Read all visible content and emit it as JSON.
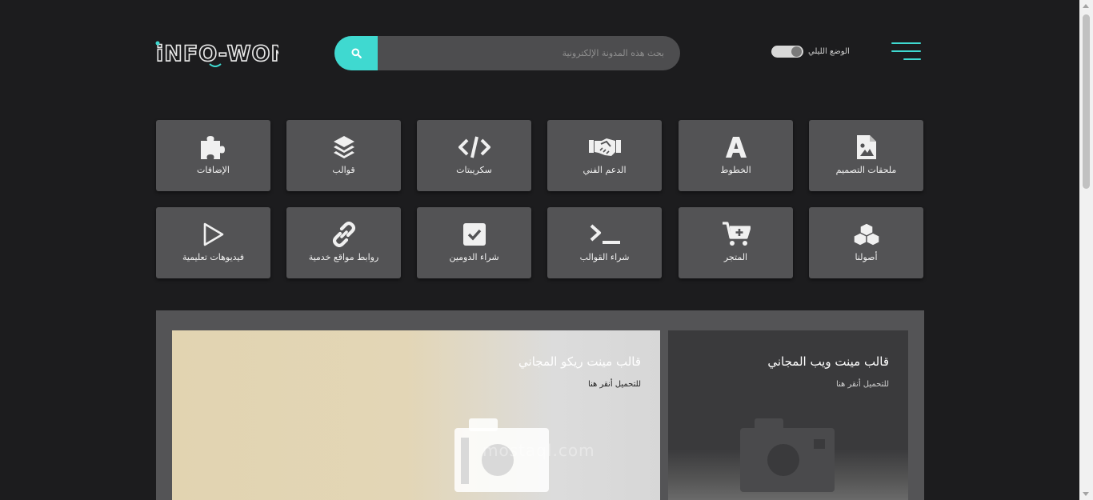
{
  "header": {
    "logo_text": "iNFO-WON",
    "search": {
      "placeholder": "بحث هذه المدونة الإلكترونية"
    },
    "night_mode_label": "الوضع الليلي"
  },
  "tiles_row1": [
    {
      "label": "ملحقات التصميم",
      "icon": "image-file-icon"
    },
    {
      "label": "الخطوط",
      "icon": "font-icon"
    },
    {
      "label": "الدعم الفني",
      "icon": "handshake-icon"
    },
    {
      "label": "سكريبتات",
      "icon": "code-icon"
    },
    {
      "label": "قوالب",
      "icon": "layers-icon"
    },
    {
      "label": "الإضافات",
      "icon": "puzzle-icon"
    }
  ],
  "tiles_row2": [
    {
      "label": "أصولنا",
      "icon": "cubes-icon"
    },
    {
      "label": "المتجر",
      "icon": "cart-plus-icon"
    },
    {
      "label": "شراء القوالب",
      "icon": "terminal-icon"
    },
    {
      "label": "شراء الدومين",
      "icon": "checkbox-icon"
    },
    {
      "label": "روابط مواقع خدمية",
      "icon": "link-icon"
    },
    {
      "label": "فيديوهات تعليمية",
      "icon": "play-icon"
    }
  ],
  "featured": {
    "card_right": {
      "title": "قالب مينت ويب المجاني",
      "subtitle": "للتحميل أنقر هنا"
    },
    "card_left": {
      "title": "قالب مينت ريكو المجاني",
      "subtitle": "للتحميل أنقر هنا",
      "watermark": "mostaql.com"
    }
  },
  "colors": {
    "accent": "#3fd9d0",
    "background": "#1c1c1e",
    "tile": "#535355"
  }
}
